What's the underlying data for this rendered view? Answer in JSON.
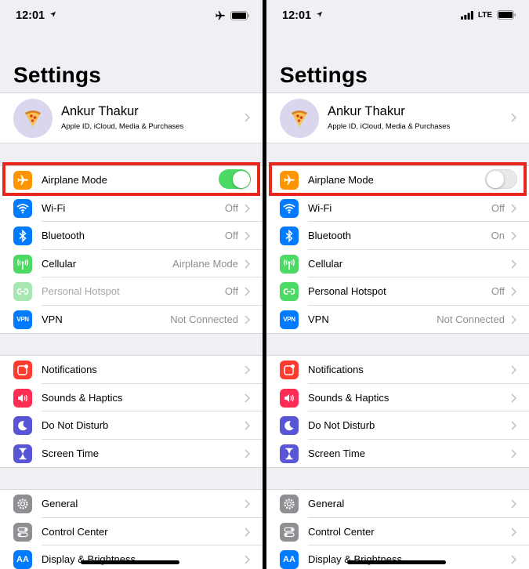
{
  "phones": [
    {
      "status": {
        "time": "12:01",
        "right_mode": "airplane"
      },
      "title": "Settings",
      "profile": {
        "name": "Ankur Thakur",
        "subtitle": "Apple ID, iCloud, Media & Purchases"
      },
      "connectivity": [
        {
          "label": "Airplane Mode",
          "toggle": "on"
        },
        {
          "label": "Wi-Fi",
          "value": "Off"
        },
        {
          "label": "Bluetooth",
          "value": "Off"
        },
        {
          "label": "Cellular",
          "value": "Airplane Mode"
        },
        {
          "label": "Personal Hotspot",
          "value": "Off",
          "disabled": true
        },
        {
          "label": "VPN",
          "value": "Not Connected"
        }
      ],
      "notifications_group": [
        {
          "label": "Notifications"
        },
        {
          "label": "Sounds & Haptics"
        },
        {
          "label": "Do Not Disturb"
        },
        {
          "label": "Screen Time"
        }
      ],
      "general_group": [
        {
          "label": "General"
        },
        {
          "label": "Control Center"
        },
        {
          "label": "Display & Brightness"
        }
      ]
    },
    {
      "status": {
        "time": "12:01",
        "right_mode": "cellular",
        "network": "LTE"
      },
      "title": "Settings",
      "profile": {
        "name": "Ankur Thakur",
        "subtitle": "Apple ID, iCloud, Media & Purchases"
      },
      "connectivity": [
        {
          "label": "Airplane Mode",
          "toggle": "off"
        },
        {
          "label": "Wi-Fi",
          "value": "Off"
        },
        {
          "label": "Bluetooth",
          "value": "On"
        },
        {
          "label": "Cellular",
          "value": ""
        },
        {
          "label": "Personal Hotspot",
          "value": "Off",
          "disabled": false
        },
        {
          "label": "VPN",
          "value": "Not Connected"
        }
      ],
      "notifications_group": [
        {
          "label": "Notifications"
        },
        {
          "label": "Sounds & Haptics"
        },
        {
          "label": "Do Not Disturb"
        },
        {
          "label": "Screen Time"
        }
      ],
      "general_group": [
        {
          "label": "General"
        },
        {
          "label": "Control Center"
        },
        {
          "label": "Display & Brightness"
        }
      ]
    }
  ],
  "icons": {
    "airplane": "airplane-icon",
    "wifi": "wifi-icon",
    "bluetooth": "bluetooth-icon",
    "cellular": "cellular-antenna-icon",
    "hotspot": "personal-hotspot-icon",
    "vpn": "vpn-icon",
    "notifications": "notifications-icon",
    "sounds": "speaker-icon",
    "dnd": "moon-icon",
    "screentime": "hourglass-icon",
    "general": "gear-icon",
    "control_center": "toggles-icon",
    "display": "display-brightness-icon",
    "avatar": "pizza-icon"
  },
  "colors": {
    "highlight": "#e8281f",
    "toggle_on": "#4cd964",
    "airplane": "#ff9500",
    "wifi": "#007aff",
    "cellular": "#4cd964",
    "notifications": "#ff3b30",
    "sounds": "#ff2d55",
    "dnd": "#5856d6",
    "screentime": "#5856d6",
    "general": "#8e8e93"
  }
}
